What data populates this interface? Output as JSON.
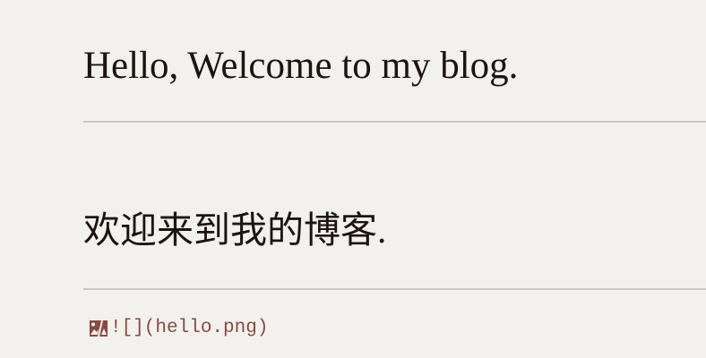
{
  "content": {
    "heading_en": "Hello, Welcome to my blog.",
    "heading_zh": "欢迎来到我的博客.",
    "image_markdown": "![](hello.png)",
    "image_icon": "broken-image-icon"
  },
  "colors": {
    "background": "#f3f1ed",
    "text": "#1c1412",
    "rule": "#c9c8c4",
    "code": "#8a4a40"
  }
}
